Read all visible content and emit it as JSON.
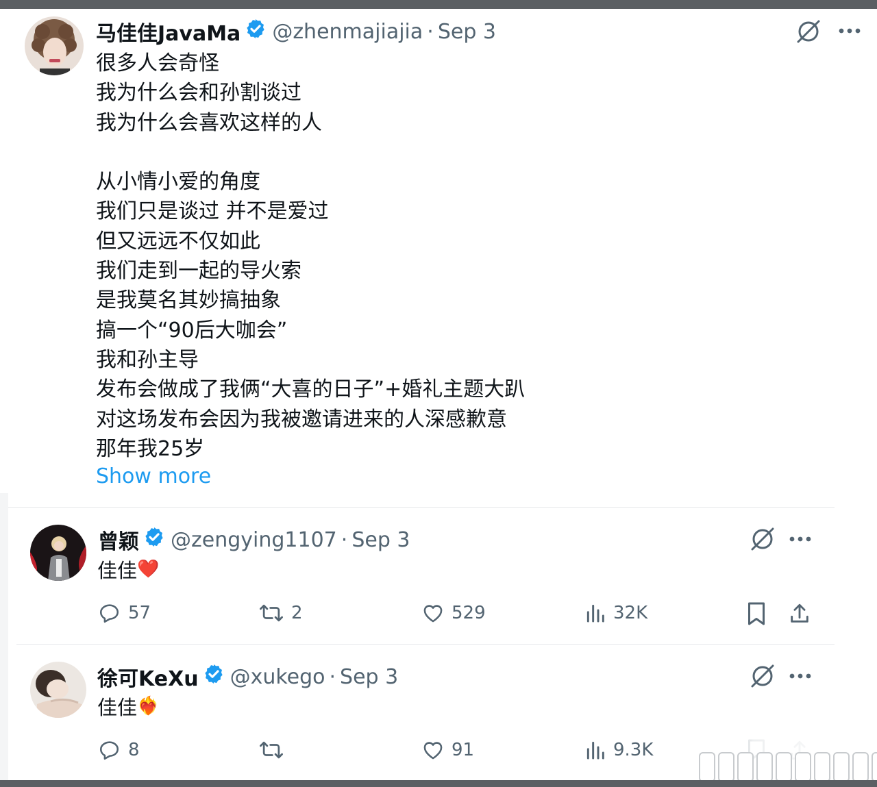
{
  "main_tweet": {
    "name": "马佳佳JavaMa",
    "handle": "@zhenmajiajia",
    "date": "Sep 3",
    "lines": [
      "很多人会奇怪",
      "我为什么会和孙割谈过",
      "我为什么会喜欢这样的人",
      "",
      "从小情小爱的角度",
      "我们只是谈过 并不是爱过",
      "但又远远不仅如此",
      "我们走到一起的导火索",
      "是我莫名其妙搞抽象",
      "搞一个“90后大咖会”",
      "我和孙主导",
      "发布会做成了我俩“大喜的日子”+婚礼主题大趴",
      "对这场发布会因为我被邀请进来的人深感歉意",
      "那年我25岁"
    ],
    "show_more": "Show more"
  },
  "replies": [
    {
      "name": "曾颖",
      "handle": "@zengying1107",
      "date": "Sep 3",
      "text": "佳佳",
      "emoji": "❤️",
      "replies": "57",
      "retweets": "2",
      "likes": "529",
      "views": "32K"
    },
    {
      "name": "徐可KeXu",
      "handle": "@xukego",
      "date": "Sep 3",
      "text": "佳佳",
      "emoji": "❤️‍🔥",
      "replies": "8",
      "retweets": "",
      "likes": "91",
      "views": "9.3K"
    }
  ],
  "colors": {
    "verified": "#1d9bf0",
    "link": "#1d9bf0",
    "secondary_text": "#536471"
  },
  "icons": [
    "verified-badge-icon",
    "grok-icon",
    "more-icon",
    "reply-icon",
    "retweet-icon",
    "like-icon",
    "views-icon",
    "bookmark-icon",
    "share-icon"
  ]
}
